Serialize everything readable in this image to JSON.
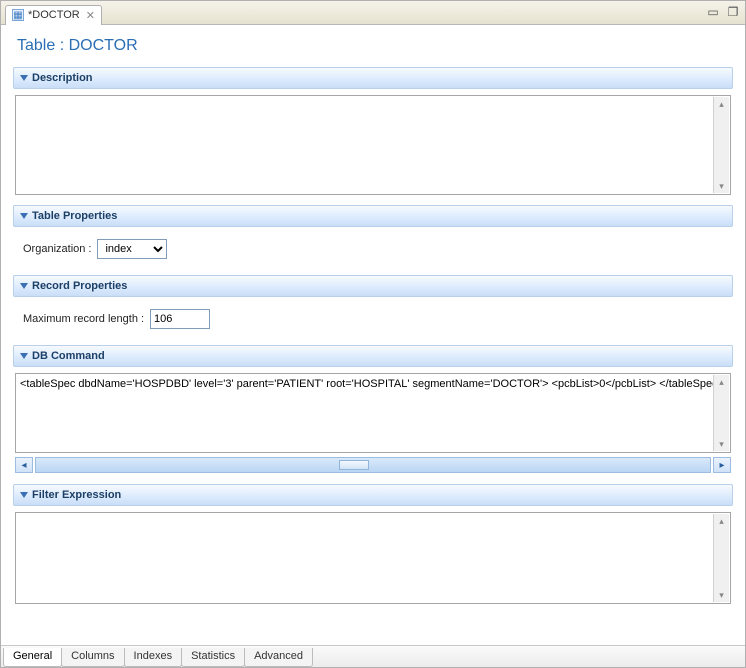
{
  "editor_tab": {
    "title": "*DOCTOR"
  },
  "page_title": "Table : DOCTOR",
  "sections": {
    "description": {
      "title": "Description",
      "value": ""
    },
    "table_properties": {
      "title": "Table Properties",
      "organization_label": "Organization :",
      "organization_value": "index",
      "organization_options": [
        "index"
      ]
    },
    "record_properties": {
      "title": "Record Properties",
      "max_record_length_label": "Maximum record length :",
      "max_record_length_value": "106"
    },
    "db_command": {
      "title": "DB Command",
      "value": "<tableSpec dbdName='HOSPDBD' level='3' parent='PATIENT' root='HOSPITAL' segmentName='DOCTOR'> <pcbList>0</pcbList> </tableSpec"
    },
    "filter_expression": {
      "title": "Filter Expression",
      "value": ""
    }
  },
  "bottom_tabs": [
    "General",
    "Columns",
    "Indexes",
    "Statistics",
    "Advanced"
  ],
  "active_bottom_tab": "General"
}
